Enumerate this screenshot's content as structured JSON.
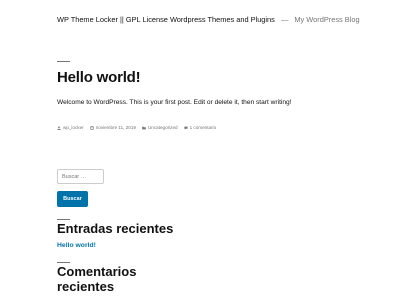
{
  "header": {
    "site_title": "WP Theme Locker || GPL License Wordpress Themes and Plugins",
    "separator": "—",
    "site_description": "My WordPress Blog"
  },
  "post": {
    "title": "Hello world!",
    "body": "Welcome to WordPress. This is your first post. Edit or delete it, then start writing!",
    "meta": {
      "author": "wp_locker",
      "date": "noviembre 11, 2019",
      "category": "Uncategorized",
      "comments": "1 comentario"
    }
  },
  "search": {
    "placeholder": "Buscar …",
    "button_label": "Buscar"
  },
  "widgets": {
    "recent_posts_title": "Entradas recientes",
    "recent_posts": [
      "Hello world!"
    ],
    "recent_comments_title_line1": "Comentarios",
    "recent_comments_title_line2": "recientes"
  },
  "colors": {
    "accent": "#0073aa",
    "text": "#111111",
    "muted": "#767676"
  }
}
